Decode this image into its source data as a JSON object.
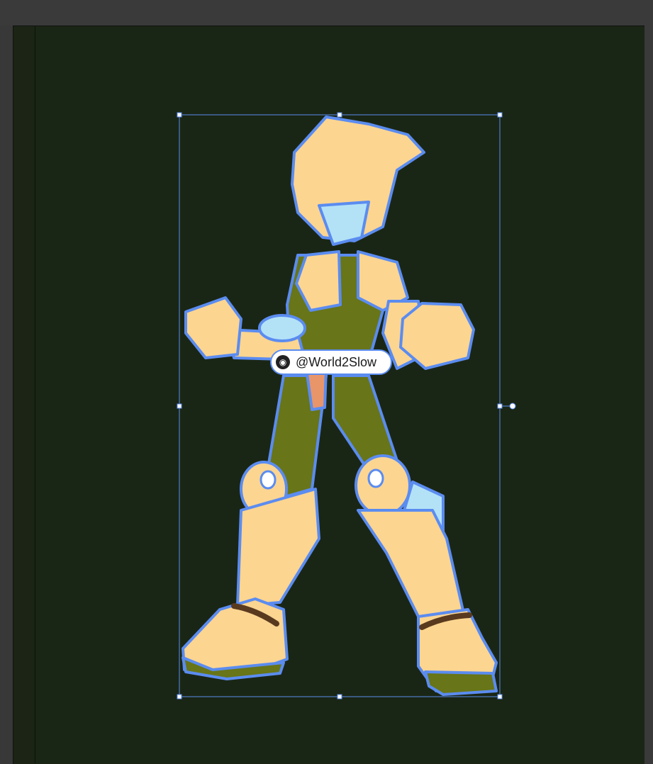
{
  "canvas": {
    "background_color": "#383838",
    "artboard_color": "#1a2615"
  },
  "selection": {
    "color": "#5b8cf0",
    "label_text": "@World2Slow",
    "label_icon": "camera-icon"
  },
  "artwork": {
    "subject": "armored-hero-character",
    "palette": {
      "skin": "#fcd591",
      "armor_green": "#687518",
      "outline": "#5b8cf0",
      "visor_blue": "#b3e2f7",
      "belt_brown": "#5a3a1e",
      "accent_orange": "#e8956a"
    }
  }
}
